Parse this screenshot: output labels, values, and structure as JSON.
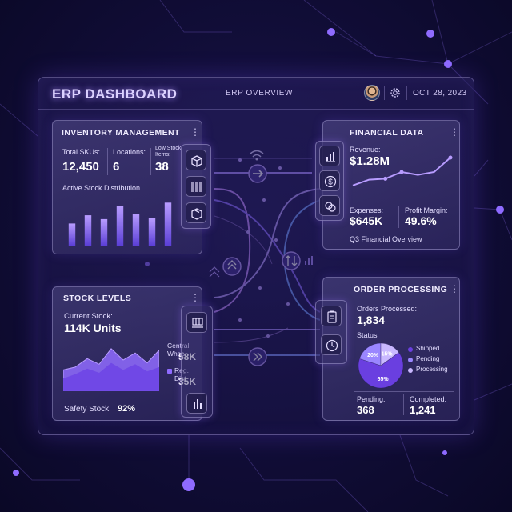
{
  "header": {
    "app_title": "ERP DASHBOARD",
    "subtitle": "ERP OVERVIEW",
    "date": "OCT 28, 2023",
    "icons": [
      "avatar",
      "gear-icon"
    ]
  },
  "inventory": {
    "title": "INVENTORY MANAGEMENT",
    "total_skus_label": "Total SKUs:",
    "total_skus": "12,450",
    "locations_label": "Locations:",
    "locations": "6",
    "low_stock_label_1": "Low Stock",
    "low_stock_label_2": "Items:",
    "low_stock": "38",
    "chart_label": "Active Stock Distribution",
    "icons": [
      "box-icon",
      "barcode-icon",
      "package-icon"
    ]
  },
  "financial": {
    "title": "FINANCIAL DATA",
    "revenue_label": "Revenue:",
    "revenue": "$1.28M",
    "expenses_label": "Expenses:",
    "expenses": "$645K",
    "profit_label": "Profit Margin:",
    "profit": "49.6%",
    "footer": "Q3 Financial Overview",
    "icons": [
      "bar-chart-icon",
      "dollar-icon",
      "coins-icon"
    ]
  },
  "stock": {
    "title": "STOCK LEVELS",
    "current_label": "Current Stock:",
    "current": "114K Units",
    "central_label": "Central Whse",
    "central": "58K",
    "reg_label": "Reg. Dist",
    "reg": "35K",
    "safety_label": "Safety Stock:",
    "safety": "92%",
    "icons": [
      "pallet-icon",
      "bars-icon"
    ]
  },
  "orders": {
    "title": "ORDER PROCESSING",
    "processed_label": "Orders Processed:",
    "processed": "1,834",
    "status_label": "Status",
    "pending_label": "Pending:",
    "pending": "368",
    "completed_label": "Completed:",
    "completed": "1,241",
    "icons": [
      "clipboard-icon",
      "clock-icon"
    ]
  },
  "colors": {
    "accent": "#8f6bff",
    "accent_light": "#b89cff",
    "accent_dark": "#5b3fd6",
    "background": "#120e3a"
  },
  "chart_data": [
    {
      "type": "bar",
      "values": [
        40,
        55,
        48,
        72,
        58,
        50,
        78
      ],
      "ylim": [
        0,
        90
      ]
    },
    {
      "type": "line",
      "values": [
        12,
        24,
        26,
        40,
        34,
        40,
        70
      ],
      "ylim": [
        0,
        80
      ]
    },
    {
      "type": "area",
      "series": [
        {
          "values": [
            30,
            34,
            46,
            38,
            60,
            44,
            54,
            40,
            58
          ]
        },
        {
          "values": [
            18,
            24,
            32,
            26,
            40,
            30,
            38,
            28,
            34
          ]
        }
      ],
      "ylim": [
        0,
        70
      ]
    },
    {
      "type": "pie",
      "categories": [
        "Shipped",
        "Pending",
        "Processing"
      ],
      "values": [
        65,
        20,
        15
      ],
      "labels": [
        "65%",
        "20%",
        "15%"
      ]
    }
  ]
}
